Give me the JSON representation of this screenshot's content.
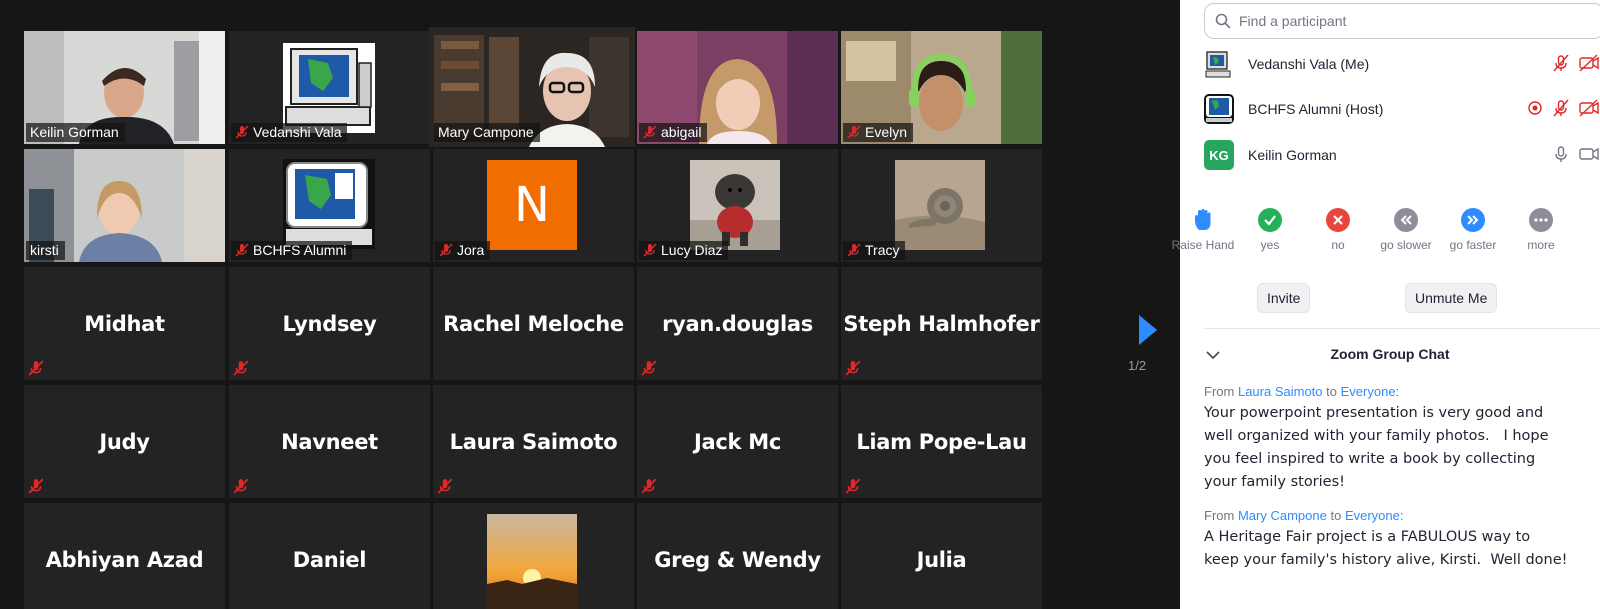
{
  "gallery": {
    "video_tiles": [
      {
        "name": "Keilin Gorman",
        "muted": false
      },
      {
        "name": "Vedanshi Vala",
        "muted": true
      },
      {
        "name": "Mary Campone",
        "muted": false,
        "active_speaker": true
      },
      {
        "name": "abigail",
        "muted": true
      },
      {
        "name": "Evelyn",
        "muted": true
      },
      {
        "name": "kirsti",
        "muted": false
      },
      {
        "name": "BCHFS Alumni",
        "muted": true
      },
      {
        "name": "Jora",
        "muted": true,
        "avatar_letter": "N"
      },
      {
        "name": "Lucy Diaz",
        "muted": true
      },
      {
        "name": "Tracy",
        "muted": true
      }
    ],
    "name_tiles": [
      {
        "name": "Midhat"
      },
      {
        "name": "Lyndsey"
      },
      {
        "name": "Rachel Meloche"
      },
      {
        "name": "ryan.douglas"
      },
      {
        "name": "Steph Halmhofer"
      },
      {
        "name": "Judy"
      },
      {
        "name": "Navneet"
      },
      {
        "name": "Laura Saimoto"
      },
      {
        "name": "Jack Mc"
      },
      {
        "name": "Liam Pope-Lau"
      },
      {
        "name": "Abhiyan Azad"
      },
      {
        "name": "Daniel"
      },
      {
        "name": ""
      },
      {
        "name": "Greg & Wendy"
      },
      {
        "name": "Julia"
      }
    ],
    "page_indicator": "1/2",
    "colors": {
      "active_border": "#d9e86b",
      "muted_red": "#e02828",
      "next_arrow": "#2d8cff",
      "avatar_orange": "#f26d00"
    }
  },
  "panel": {
    "search_placeholder": "Find a participant",
    "participants": [
      {
        "name": "Vedanshi Vala (Me)",
        "icons": [
          "mic-muted-icon",
          "video-off-icon"
        ]
      },
      {
        "name": "BCHFS Alumni (Host)",
        "icons": [
          "recording-icon",
          "mic-muted-icon",
          "video-off-icon"
        ]
      },
      {
        "name": "Keilin Gorman",
        "initials": "KG",
        "icons": [
          "mic-icon",
          "video-icon"
        ]
      }
    ],
    "reactions": [
      {
        "label": "Raise Hand",
        "icon": "raise-hand-icon"
      },
      {
        "label": "yes",
        "icon": "check-icon",
        "color": "#25b059"
      },
      {
        "label": "no",
        "icon": "x-icon",
        "color": "#e8453c"
      },
      {
        "label": "go slower",
        "icon": "rewind-icon",
        "color": "#8e8e9a"
      },
      {
        "label": "go faster",
        "icon": "fast-forward-icon",
        "color": "#2d8cff"
      },
      {
        "label": "more",
        "icon": "more-icon",
        "color": "#8e8e9a"
      }
    ],
    "invite_label": "Invite",
    "unmute_label": "Unmute Me",
    "chat": {
      "title": "Zoom Group Chat",
      "messages": [
        {
          "from_word": "From",
          "sender": "Laura Saimoto",
          "to_word": "to",
          "recipient": "Everyone",
          "lines": [
            "Your powerpoint presentation is very good and",
            "well organized with your family photos.   I hope",
            "you feel inspired to write a book by collecting",
            "your family stories!"
          ]
        },
        {
          "from_word": "From",
          "sender": "Mary Campone",
          "to_word": "to",
          "recipient": "Everyone",
          "lines": [
            "A Heritage Fair project is a FABULOUS way to",
            "keep your family's history alive, Kirsti.  Well done!"
          ]
        }
      ]
    }
  }
}
